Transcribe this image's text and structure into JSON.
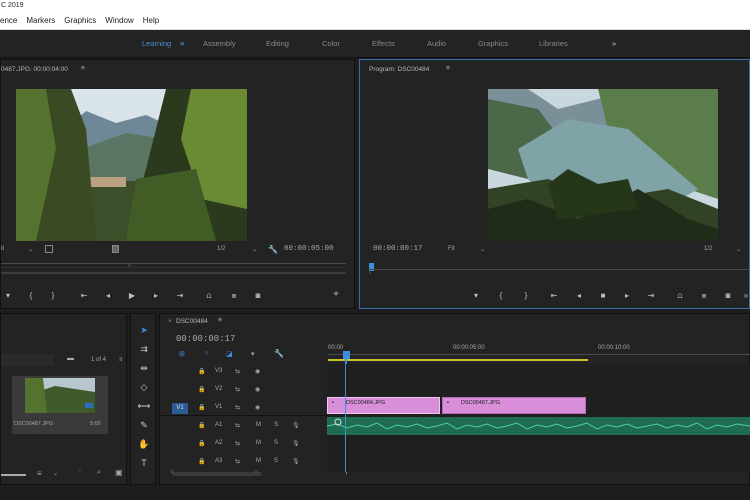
{
  "window": {
    "title": "C 2019"
  },
  "menu": [
    "ence",
    "Markers",
    "Graphics",
    "Window",
    "Help"
  ],
  "workspaces": {
    "items": [
      "Learning",
      "Assembly",
      "Editing",
      "Color",
      "Effects",
      "Audio",
      "Graphics",
      "Libraries"
    ],
    "active": "Learning",
    "more": "»"
  },
  "source": {
    "title": "0487.JPG: 00:00:04:00",
    "fit": "it",
    "resolution": "1/2",
    "duration": "00:00:05:00"
  },
  "program": {
    "title": "Program: DSC00484",
    "timecode": "00:00:00:17",
    "fit": "Fit",
    "resolution": "1/2"
  },
  "project": {
    "count": "1 of 4",
    "clip_name": "DSC00487.JPG",
    "clip_duration": "5:00"
  },
  "timeline": {
    "tab": "DSC00484",
    "timecode": "00:00:00:17",
    "ruler": [
      "00:00",
      "00:00:05:00",
      "00:00:10:00"
    ],
    "tracks": [
      {
        "name": "V3",
        "type": "video"
      },
      {
        "name": "V2",
        "type": "video"
      },
      {
        "name": "V1",
        "type": "video",
        "target": true
      },
      {
        "name": "A1",
        "type": "audio",
        "m": "M",
        "s": "S"
      },
      {
        "name": "A2",
        "type": "audio",
        "m": "M",
        "s": "S"
      },
      {
        "name": "A3",
        "type": "audio",
        "m": "M",
        "s": "S"
      }
    ],
    "target_label": "V1",
    "clips": [
      "DSC00484.JPG",
      "DSC00487.JPG"
    ]
  },
  "colors": {
    "accent": "#3e8ee0",
    "video_clip": "#d88ed8",
    "audio_clip": "#2e9c78",
    "work_area": "#c9c22c"
  }
}
